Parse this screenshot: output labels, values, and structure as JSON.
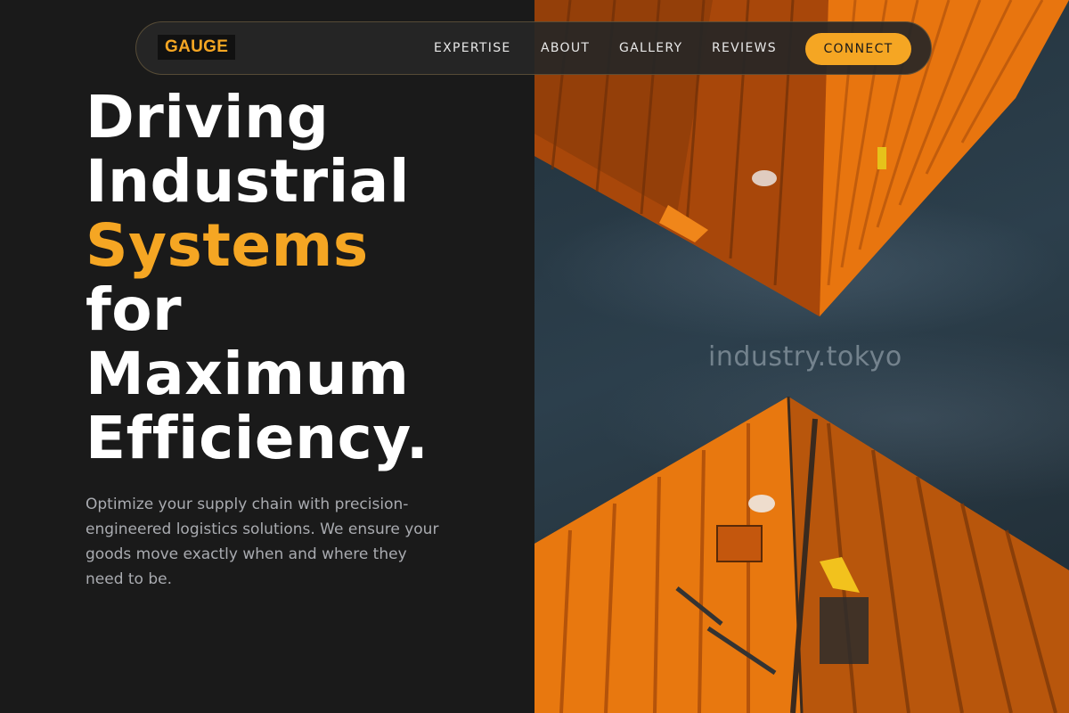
{
  "brand": {
    "logo": "GAUGE",
    "accent_color": "#f5a623"
  },
  "nav": {
    "links": [
      "EXPERTISE",
      "ABOUT",
      "GALLERY",
      "REVIEWS"
    ],
    "cta": "CONNECT"
  },
  "hero": {
    "headline_lines": [
      "Driving",
      "Industrial",
      "Systems",
      "for",
      "Maximum",
      "Efficiency."
    ],
    "accent_line": "Systems",
    "subtext": "Optimize your supply chain with precision-engineered logistics solutions. We ensure your goods move exactly when and where they need to be."
  },
  "photo": {
    "watermark": "industry.tokyo",
    "subject": "shipping-containers-looking-up"
  }
}
